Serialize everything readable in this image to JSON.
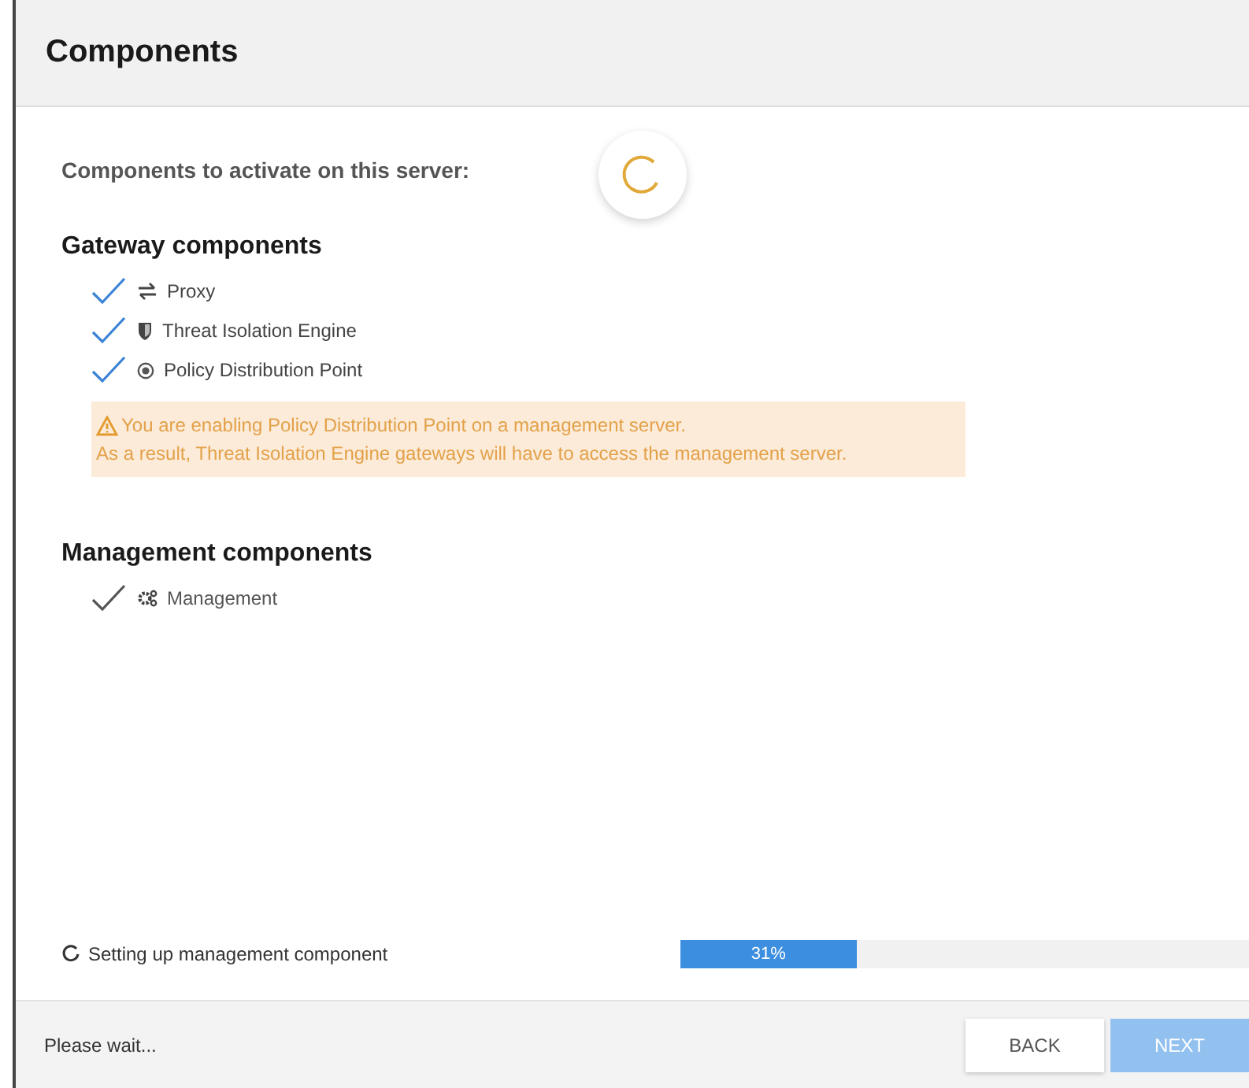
{
  "header": {
    "title": "Components"
  },
  "intro": "Components to activate on this server:",
  "sections": [
    {
      "title": "Gateway components",
      "items": [
        {
          "label": "Proxy",
          "checked": true,
          "disabled": false
        },
        {
          "label": "Threat Isolation Engine",
          "checked": true,
          "disabled": false
        },
        {
          "label": "Policy Distribution Point",
          "checked": true,
          "disabled": false
        }
      ],
      "warning": [
        "You are enabling Policy Distribution Point on a management server.",
        "As a result, Threat Isolation Engine gateways will have to access the management server."
      ]
    },
    {
      "title": "Management components",
      "items": [
        {
          "label": "Management",
          "checked": true,
          "disabled": true
        }
      ]
    }
  ],
  "status": {
    "text": "Setting up management component",
    "level": 0.31,
    "reading": "31%"
  },
  "footer": {
    "message": "Please wait...",
    "buttons": [
      {
        "label": "BACK",
        "disabled": false
      },
      {
        "label": "NEXT",
        "disabled": true
      }
    ]
  }
}
